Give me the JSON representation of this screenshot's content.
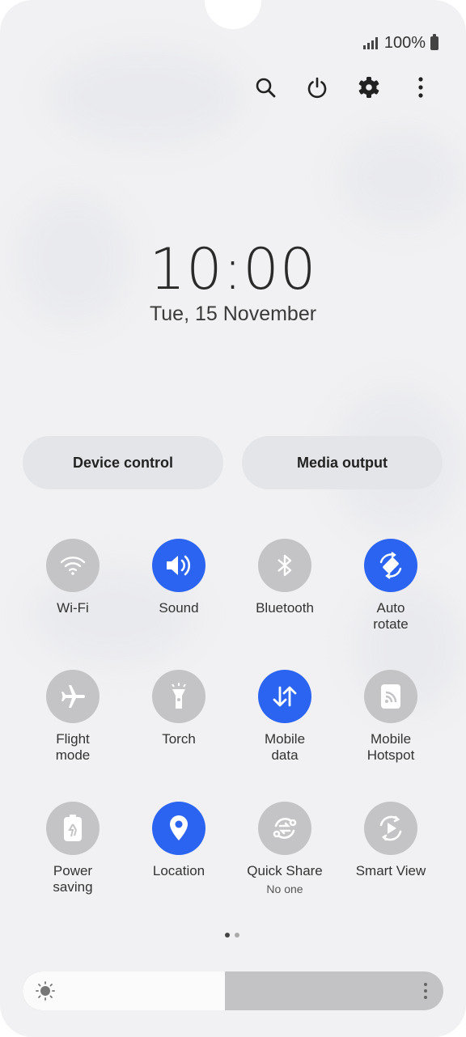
{
  "status_bar": {
    "battery_percent": "100%",
    "icons": [
      "signal-icon",
      "battery-icon"
    ]
  },
  "toolbar": {
    "icons": [
      "search-icon",
      "power-icon",
      "settings-icon",
      "more-vert-icon"
    ]
  },
  "clock": {
    "time": "10:00",
    "date": "Tue, 15 November"
  },
  "quick_buttons": {
    "device_control": "Device control",
    "media_output": "Media output"
  },
  "tiles": [
    {
      "label": "Wi-Fi",
      "icon": "wifi-icon",
      "active": false
    },
    {
      "label": "Sound",
      "icon": "sound-icon",
      "active": true
    },
    {
      "label": "Bluetooth",
      "icon": "bluetooth-icon",
      "active": false
    },
    {
      "label": "Auto\nrotate",
      "icon": "auto-rotate-icon",
      "active": true
    },
    {
      "label": "Flight\nmode",
      "icon": "airplane-icon",
      "active": false
    },
    {
      "label": "Torch",
      "icon": "torch-icon",
      "active": false
    },
    {
      "label": "Mobile\ndata",
      "icon": "mobile-data-icon",
      "active": true
    },
    {
      "label": "Mobile\nHotspot",
      "icon": "hotspot-icon",
      "active": false
    },
    {
      "label": "Power\nsaving",
      "icon": "power-saving-icon",
      "active": false
    },
    {
      "label": "Location",
      "icon": "location-icon",
      "active": true
    },
    {
      "label": "Quick Share",
      "sublabel": "No one",
      "icon": "quick-share-icon",
      "active": false
    },
    {
      "label": "Smart View",
      "icon": "smart-view-icon",
      "active": false
    }
  ],
  "page_indicator": {
    "current": 1,
    "total": 2
  },
  "brightness": {
    "level": 0.48,
    "icons": [
      "brightness-sun-icon",
      "more-vert-icon"
    ]
  },
  "colors": {
    "accent": "#2b64f1",
    "tile_off": "#c4c4c6",
    "panel_bg": "#f1f1f3"
  }
}
